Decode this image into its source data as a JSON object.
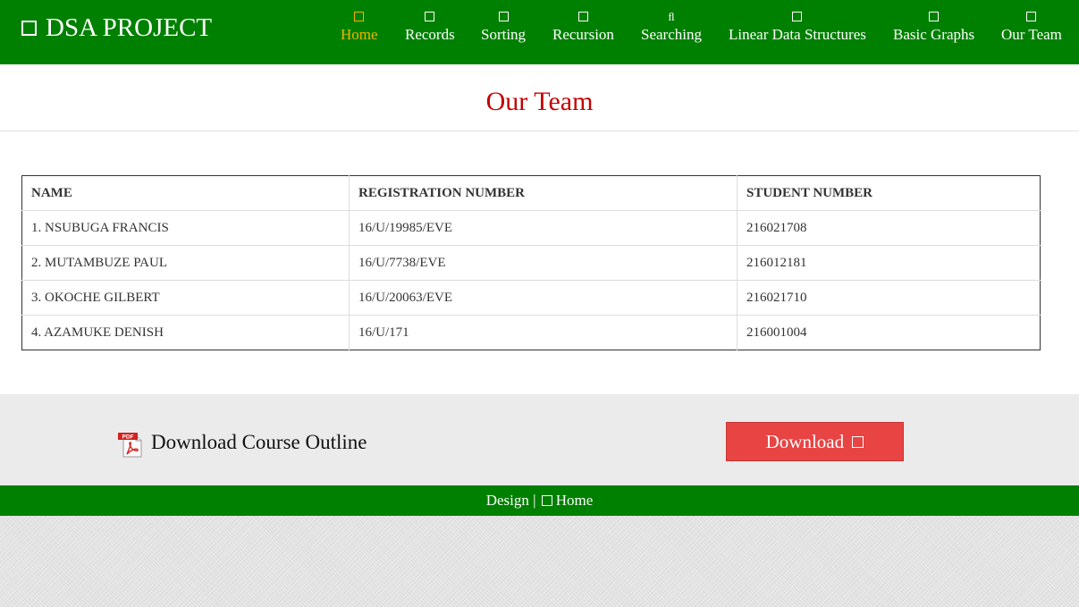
{
  "navbar": {
    "brand": "DSA PROJECT",
    "items": [
      {
        "label": "Home",
        "icon": "square-glyph-icon",
        "active": true
      },
      {
        "label": "Records",
        "icon": "square-glyph-icon"
      },
      {
        "label": "Sorting",
        "icon": "square-glyph-icon"
      },
      {
        "label": "Recursion",
        "icon": "square-glyph-icon"
      },
      {
        "label": "Searching",
        "icon": "fl-ligature-icon",
        "glyph": "ﬂ"
      },
      {
        "label": "Linear Data Structures",
        "icon": "square-glyph-icon"
      },
      {
        "label": "Basic Graphs",
        "icon": "square-glyph-icon"
      },
      {
        "label": "Our Team",
        "icon": "square-glyph-icon"
      }
    ]
  },
  "page": {
    "title": "Our Team"
  },
  "table": {
    "headers": [
      "NAME",
      "REGISTRATION NUMBER",
      "STUDENT NUMBER"
    ],
    "rows": [
      [
        "1. NSUBUGA FRANCIS",
        "16/U/19985/EVE",
        "216021708"
      ],
      [
        "2. MUTAMBUZE PAUL",
        "16/U/7738/EVE",
        "216012181"
      ],
      [
        "3. OKOCHE GILBERT",
        "16/U/20063/EVE",
        "216021710"
      ],
      [
        "4. AZAMUKE DENISH",
        "16/U/171",
        "216001004"
      ]
    ]
  },
  "download": {
    "text": "Download Course Outline",
    "button_label": "Download",
    "pdf_badge": "PDF"
  },
  "footer": {
    "design_label": "Design |",
    "home_label": "Home"
  },
  "colors": {
    "brand_green": "#008000",
    "title_red": "#c40000",
    "active_nav": "#f0b400",
    "button_red": "#e84444"
  }
}
